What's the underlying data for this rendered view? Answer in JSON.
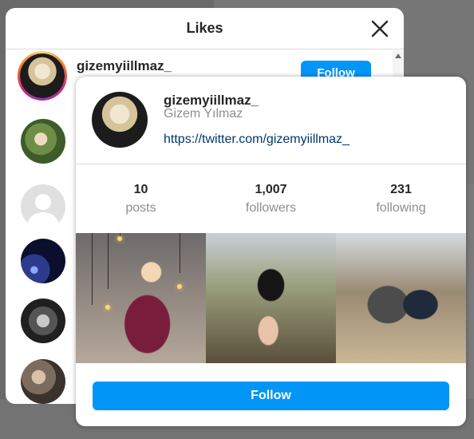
{
  "likes_modal": {
    "title": "Likes",
    "items": [
      {
        "username": "gizemyiillmaz_",
        "button": "Follow"
      }
    ]
  },
  "hover_card": {
    "username": "gizemyiillmaz_",
    "full_name": "Gizem Yılmaz",
    "link": "https://twitter.com/gizemyiillmaz_",
    "stats": [
      {
        "value": "10",
        "label": "posts"
      },
      {
        "value": "1,007",
        "label": "followers"
      },
      {
        "value": "231",
        "label": "following"
      }
    ],
    "follow_label": "Follow"
  },
  "colors": {
    "accent": "#0095f6",
    "link": "#00376b",
    "muted": "#8e8e8e"
  }
}
